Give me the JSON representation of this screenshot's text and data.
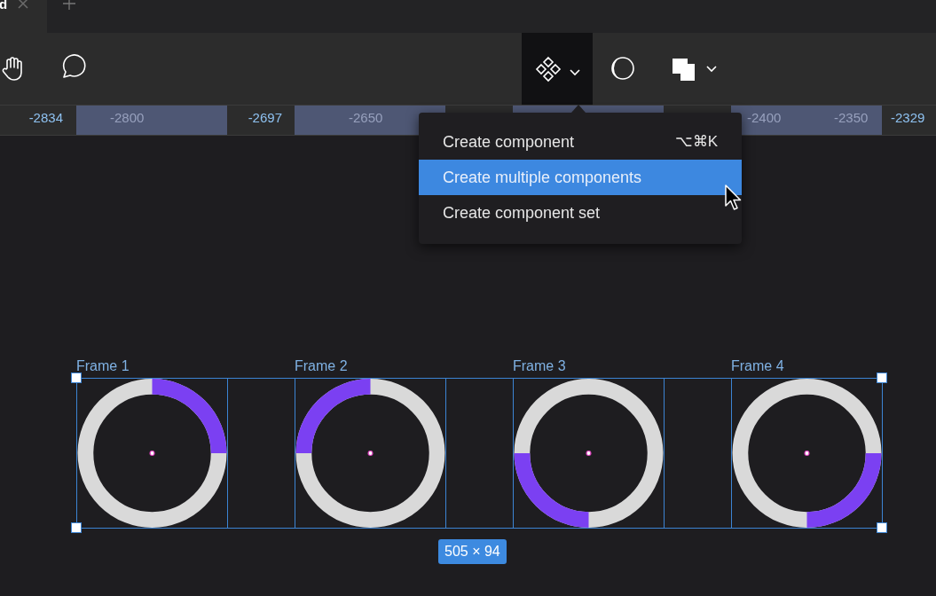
{
  "tabs": [
    {
      "label": "d",
      "selected": true
    }
  ],
  "ruler": {
    "labels": [
      {
        "text": "-2834",
        "kind": "edge"
      },
      {
        "text": "-2800",
        "kind": "tick"
      },
      {
        "text": "-2697",
        "kind": "edge"
      },
      {
        "text": "-2650",
        "kind": "tick"
      },
      {
        "text": "-2400",
        "kind": "tick"
      },
      {
        "text": "-2350",
        "kind": "tick"
      },
      {
        "text": "-2329",
        "kind": "edge"
      }
    ]
  },
  "menu": {
    "items": [
      {
        "label": "Create component",
        "shortcut": "⌥⌘K",
        "selected": false
      },
      {
        "label": "Create multiple components",
        "selected": true
      },
      {
        "label": "Create component set",
        "selected": false
      }
    ]
  },
  "frames": [
    {
      "name": "Frame 1",
      "kind": "top-right"
    },
    {
      "name": "Frame 2",
      "kind": "top-left"
    },
    {
      "name": "Frame 3",
      "kind": "bottom-left"
    },
    {
      "name": "Frame 4",
      "kind": "bottom-right"
    }
  ],
  "selection_size": "505 × 94"
}
